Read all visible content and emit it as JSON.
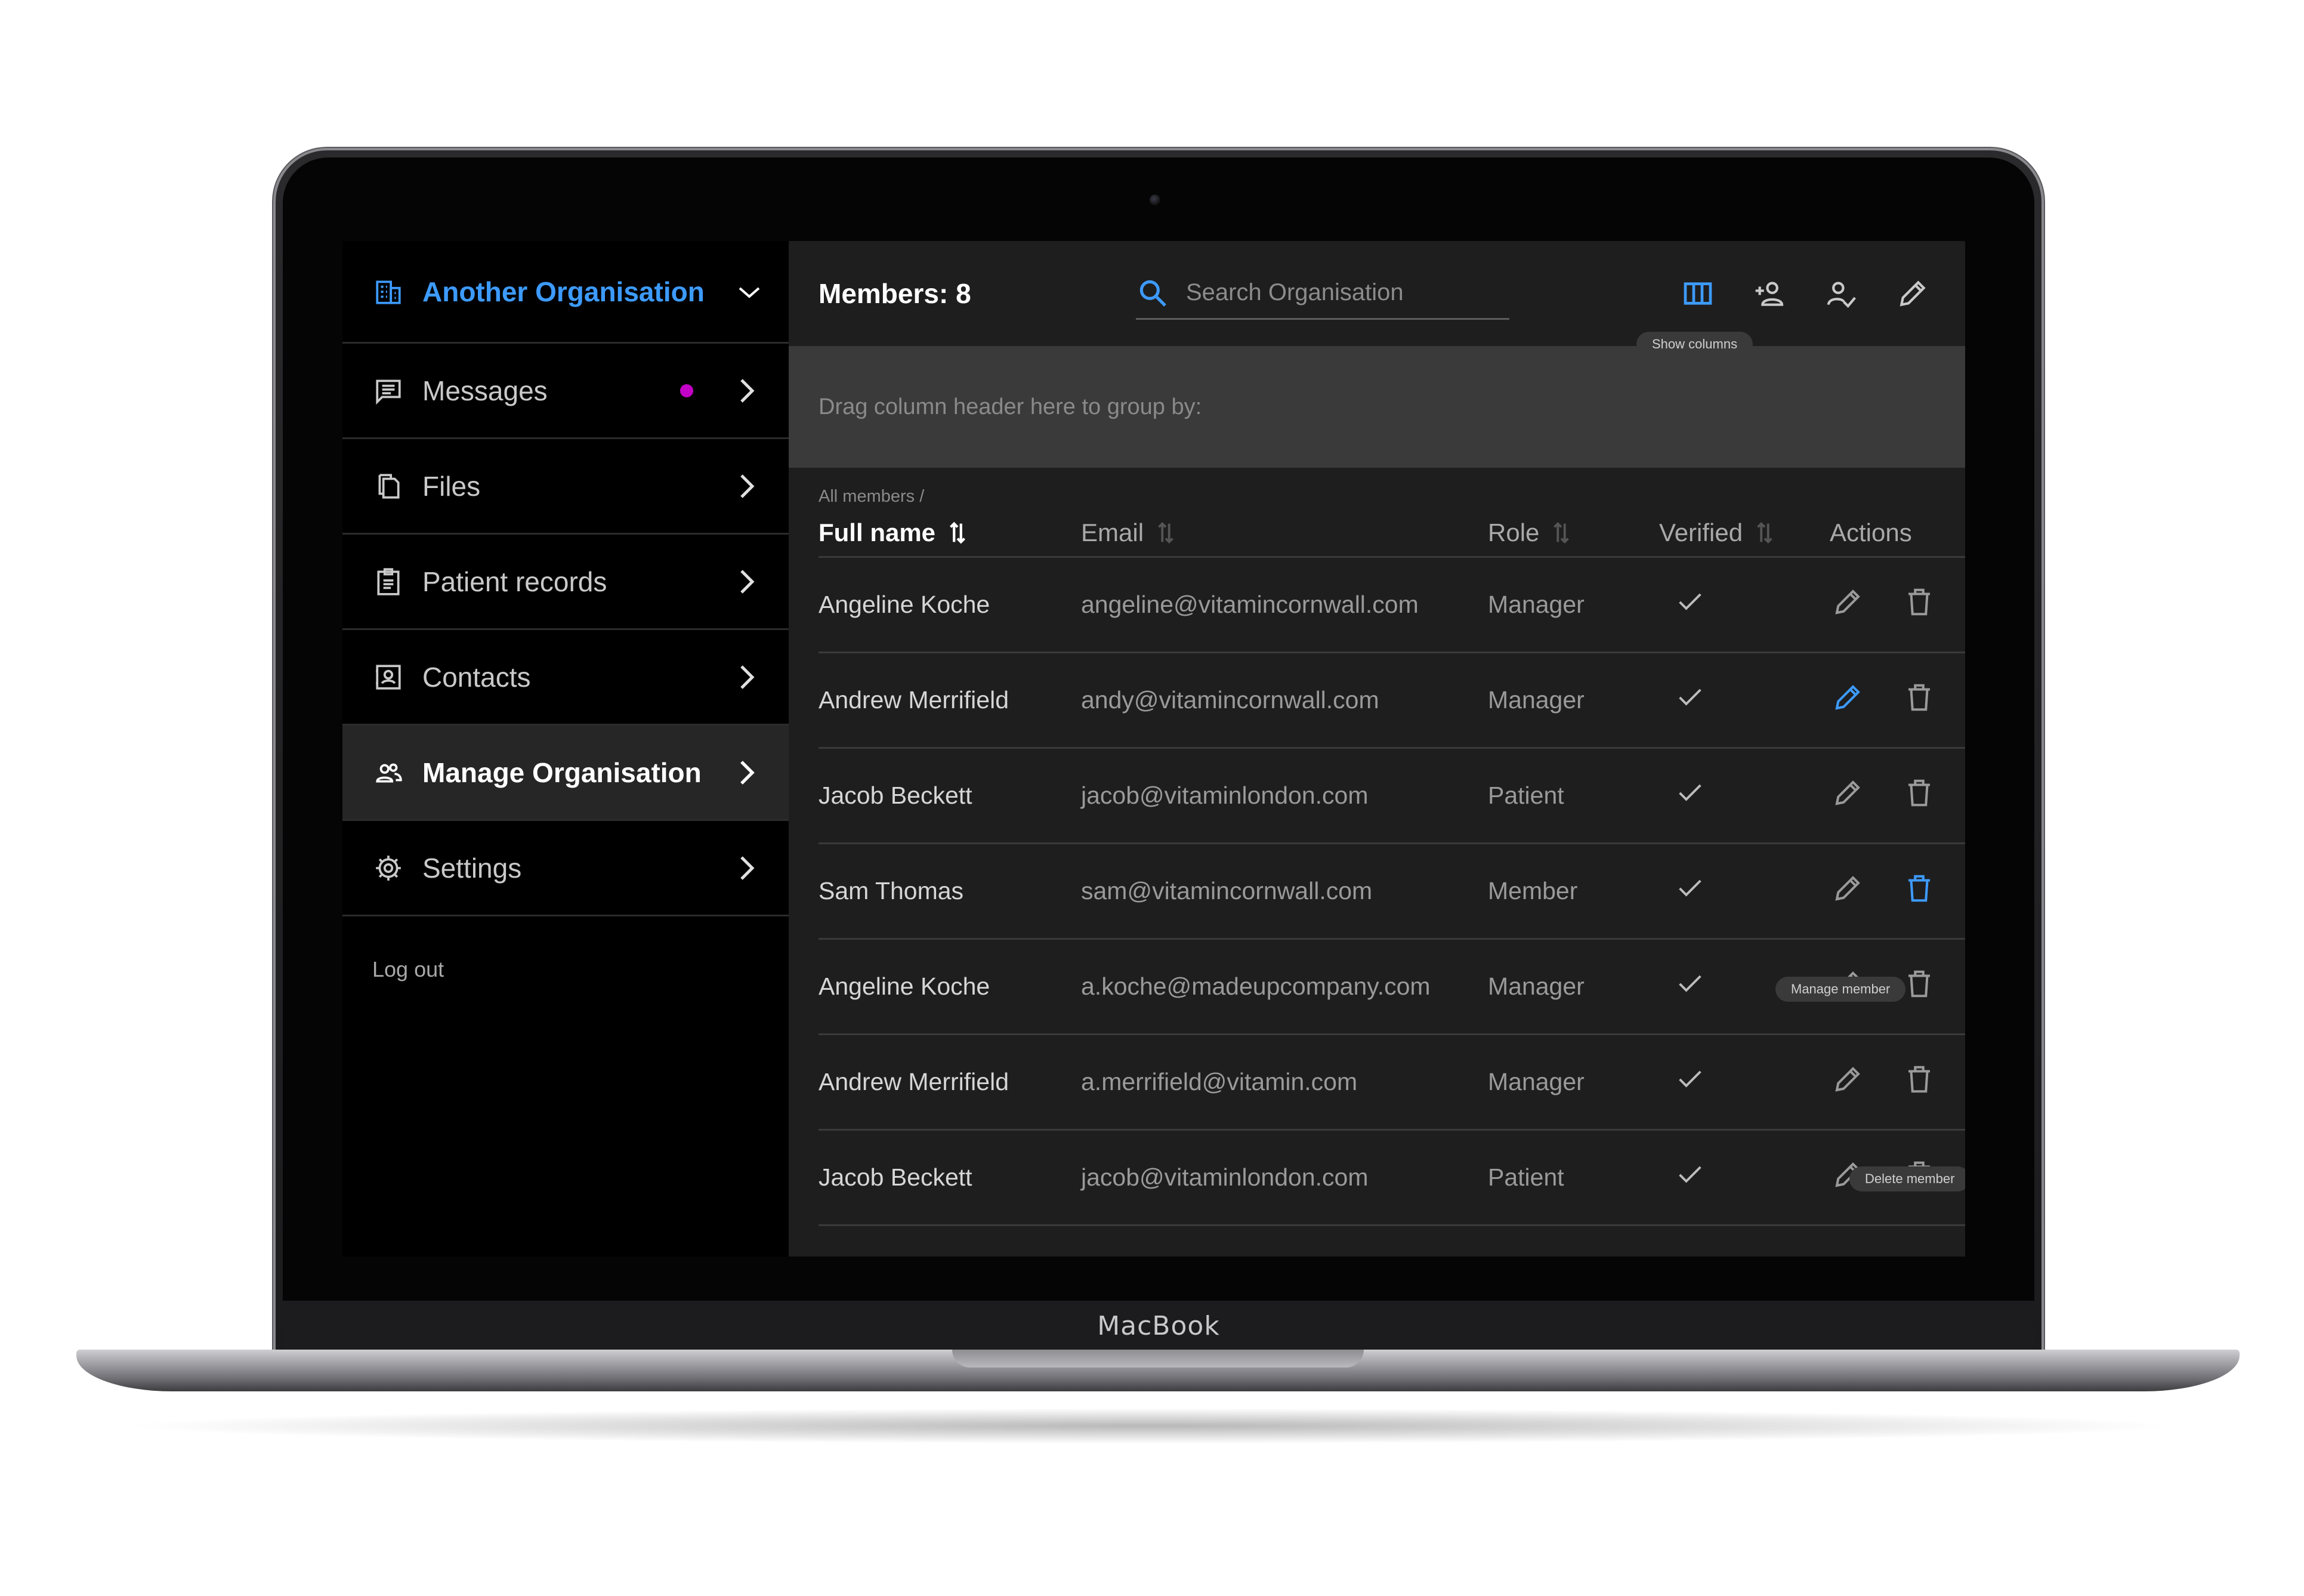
{
  "device": {
    "brand_label": "MacBook"
  },
  "sidebar": {
    "org": {
      "name": "Another Organisation",
      "icon": "building-icon"
    },
    "items": [
      {
        "label": "Messages",
        "icon": "message-icon",
        "unread": true
      },
      {
        "label": "Files",
        "icon": "files-icon"
      },
      {
        "label": "Patient records",
        "icon": "clipboard-icon"
      },
      {
        "label": "Contacts",
        "icon": "contacts-icon"
      },
      {
        "label": "Manage Organisation",
        "icon": "people-icon",
        "active": true
      },
      {
        "label": "Settings",
        "icon": "gear-icon"
      }
    ],
    "logout_label": "Log out"
  },
  "header": {
    "title": "Members: 8",
    "search_placeholder": "Search Organisation",
    "show_columns_tooltip": "Show columns"
  },
  "group_by_hint": "Drag column header here to group by:",
  "breadcrumb": "All members /",
  "columns": {
    "name": "Full name",
    "email": "Email",
    "role": "Role",
    "verified": "Verified",
    "actions": "Actions"
  },
  "rows": [
    {
      "name": "Angeline Koche",
      "email": "angeline@vitamincornwall.com",
      "role": "Manager",
      "verified": true
    },
    {
      "name": "Andrew Merrifield",
      "email": "andy@vitamincornwall.com",
      "role": "Manager",
      "verified": true
    },
    {
      "name": "Jacob Beckett",
      "email": "jacob@vitaminlondon.com",
      "role": "Patient",
      "verified": true
    },
    {
      "name": "Sam Thomas",
      "email": "sam@vitamincornwall.com",
      "role": "Member",
      "verified": true
    },
    {
      "name": "Angeline Koche",
      "email": "a.koche@madeupcompany.com",
      "role": "Manager",
      "verified": true
    },
    {
      "name": "Andrew Merrifield",
      "email": "a.merrifield@vitamin.com",
      "role": "Manager",
      "verified": true
    },
    {
      "name": "Jacob Beckett",
      "email": "jacob@vitaminlondon.com",
      "role": "Patient",
      "verified": true
    }
  ],
  "tooltips": {
    "manage_member": "Manage member",
    "delete_member": "Delete member"
  },
  "colors": {
    "accent": "#3d9bff",
    "unread_dot": "#c400c8",
    "background": "#1e1e1e"
  }
}
